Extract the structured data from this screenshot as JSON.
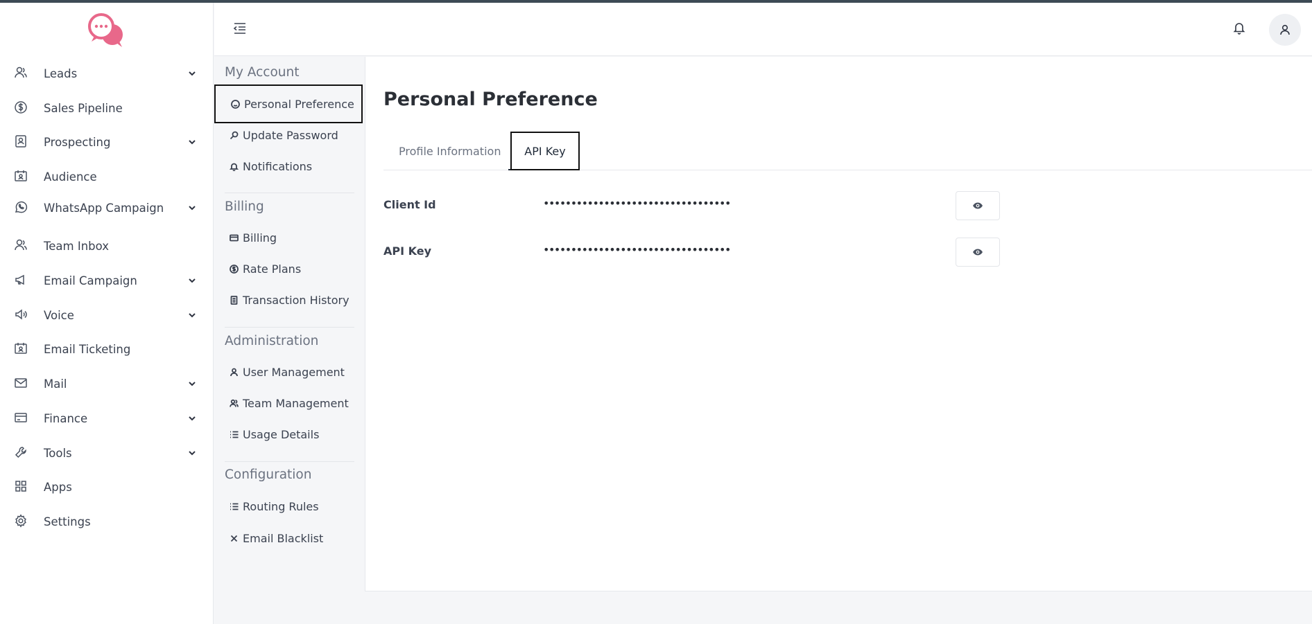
{
  "sidebar": {
    "items": [
      {
        "label": "Leads",
        "icon": "users-icon",
        "has_children": true
      },
      {
        "label": "Sales Pipeline",
        "icon": "dollar-circle-icon",
        "has_children": false
      },
      {
        "label": "Prospecting",
        "icon": "contact-card-icon",
        "has_children": true
      },
      {
        "label": "Audience",
        "icon": "calendar-user-icon",
        "has_children": false
      },
      {
        "label": "WhatsApp Campaign",
        "icon": "whatsapp-icon",
        "has_children": true
      },
      {
        "label": "Team Inbox",
        "icon": "users-icon",
        "has_children": false
      },
      {
        "label": "Email Campaign",
        "icon": "megaphone-icon",
        "has_children": true
      },
      {
        "label": "Voice",
        "icon": "speaker-icon",
        "has_children": true
      },
      {
        "label": "Email Ticketing",
        "icon": "calendar-user-icon",
        "has_children": false
      },
      {
        "label": "Mail",
        "icon": "envelope-icon",
        "has_children": true
      },
      {
        "label": "Finance",
        "icon": "credit-card-icon",
        "has_children": true
      },
      {
        "label": "Tools",
        "icon": "wrench-icon",
        "has_children": true
      },
      {
        "label": "Apps",
        "icon": "grid-icon",
        "has_children": false
      },
      {
        "label": "Settings",
        "icon": "gear-icon",
        "has_children": false
      }
    ]
  },
  "submenu": {
    "sections": [
      {
        "title": "My Account",
        "items": [
          "Personal Preference",
          "Update Password",
          "Notifications"
        ]
      },
      {
        "title": "Billing",
        "items": [
          "Billing",
          "Rate Plans",
          "Transaction History"
        ]
      },
      {
        "title": "Administration",
        "items": [
          "User Management",
          "Team Management",
          "Usage Details"
        ]
      },
      {
        "title": "Configuration",
        "items": [
          "Routing Rules",
          "Email Blacklist"
        ]
      }
    ]
  },
  "main": {
    "title": "Personal Preference",
    "tabs": [
      {
        "label": "Profile Information"
      },
      {
        "label": "API Key"
      }
    ],
    "fields": [
      {
        "label": "Client Id",
        "value": "••••••••••••••••••••••••••••••••••"
      },
      {
        "label": "API Key",
        "value": "••••••••••••••••••••••••••••••••••"
      }
    ]
  },
  "colors": {
    "brand": "#e8688a",
    "text": "#3b4250",
    "muted": "#6b7280"
  }
}
